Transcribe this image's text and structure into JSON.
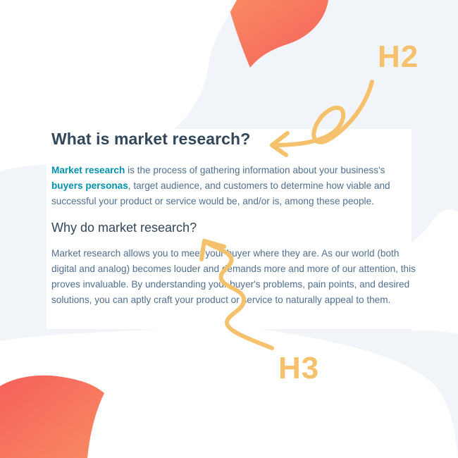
{
  "heading_h2": "What is market research?",
  "paragraph1": {
    "link1": "Market research",
    "text1": " is the process of gathering information about your business's ",
    "link2": "buyers personas",
    "text2": ", target audience, and customers to determine how viable and successful your product or service would be, and/or is, among these people."
  },
  "heading_h3": "Why do market research?",
  "paragraph2": "Market research allows you to meet your buyer where they are. As our world (both digital and analog) becomes louder and demands more and more of our attention, this proves invaluable. By understanding your buyer's problems, pain points, and desired solutions, you can aptly craft your product or service to naturally appeal to them.",
  "annotations": {
    "h2_label": "H2",
    "h3_label": "H3"
  },
  "colors": {
    "heading": "#33475b",
    "body_text": "#516f90",
    "link": "#0091ae",
    "annotation": "#f5c16c",
    "blob_coral": "#f87060",
    "background": "#f1f4f8"
  }
}
